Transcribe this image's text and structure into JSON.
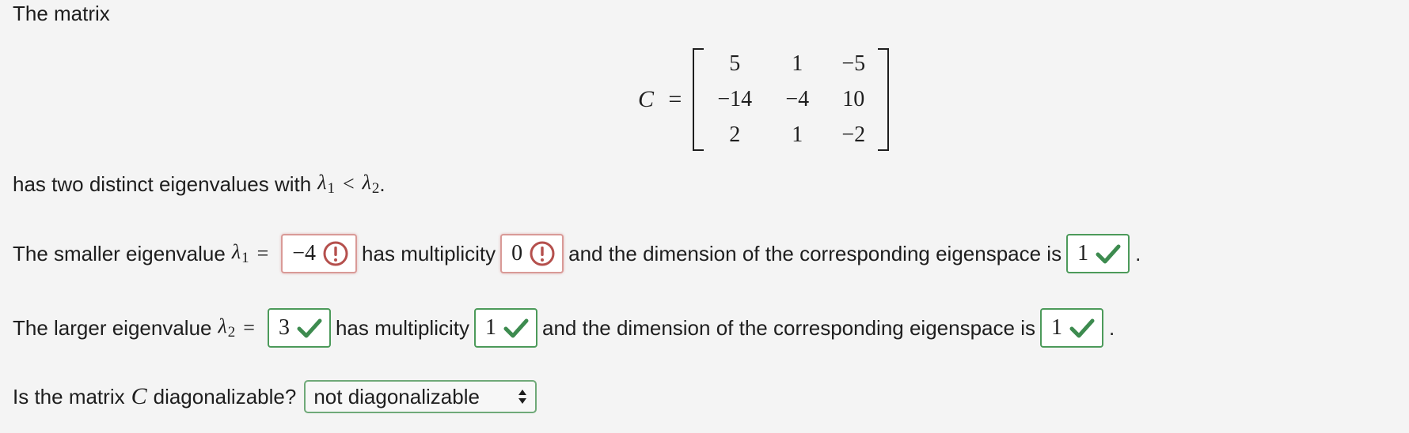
{
  "intro": "The matrix",
  "matrix": {
    "name": "C",
    "rows": [
      [
        "5",
        "1",
        "−5"
      ],
      [
        "−14",
        "−4",
        "10"
      ],
      [
        "2",
        "1",
        "−2"
      ]
    ]
  },
  "statement": {
    "text": "has two distinct eigenvalues with",
    "lambda": "λ",
    "lt": "<",
    "period": "."
  },
  "smaller": {
    "prefix": "The smaller eigenvalue",
    "lambda": "λ",
    "sub": "1",
    "eq": "=",
    "value": "−4",
    "value_status": "incorrect",
    "mult_label": "has multiplicity",
    "multiplicity": "0",
    "mult_status": "incorrect",
    "dim_label": "and the dimension of the corresponding eigenspace is",
    "dimension": "1",
    "dim_status": "correct"
  },
  "larger": {
    "prefix": "The larger eigenvalue",
    "lambda": "λ",
    "sub": "2",
    "eq": "=",
    "value": "3",
    "value_status": "correct",
    "mult_label": "has multiplicity",
    "multiplicity": "1",
    "mult_status": "correct",
    "dim_label": "and the dimension of the corresponding eigenspace is",
    "dimension": "1",
    "dim_status": "correct"
  },
  "question": {
    "prefix": "Is the matrix",
    "var": "C",
    "suffix": "diagonalizable?",
    "selected": "not diagonalizable"
  },
  "colors": {
    "correct": "#3d8b4f",
    "incorrect": "#b5504d",
    "correct_border": "#4c9a5a",
    "incorrect_border": "#d99a97"
  },
  "icons": {
    "correct": "checkmark-icon",
    "incorrect": "exclamation-circle-icon"
  }
}
